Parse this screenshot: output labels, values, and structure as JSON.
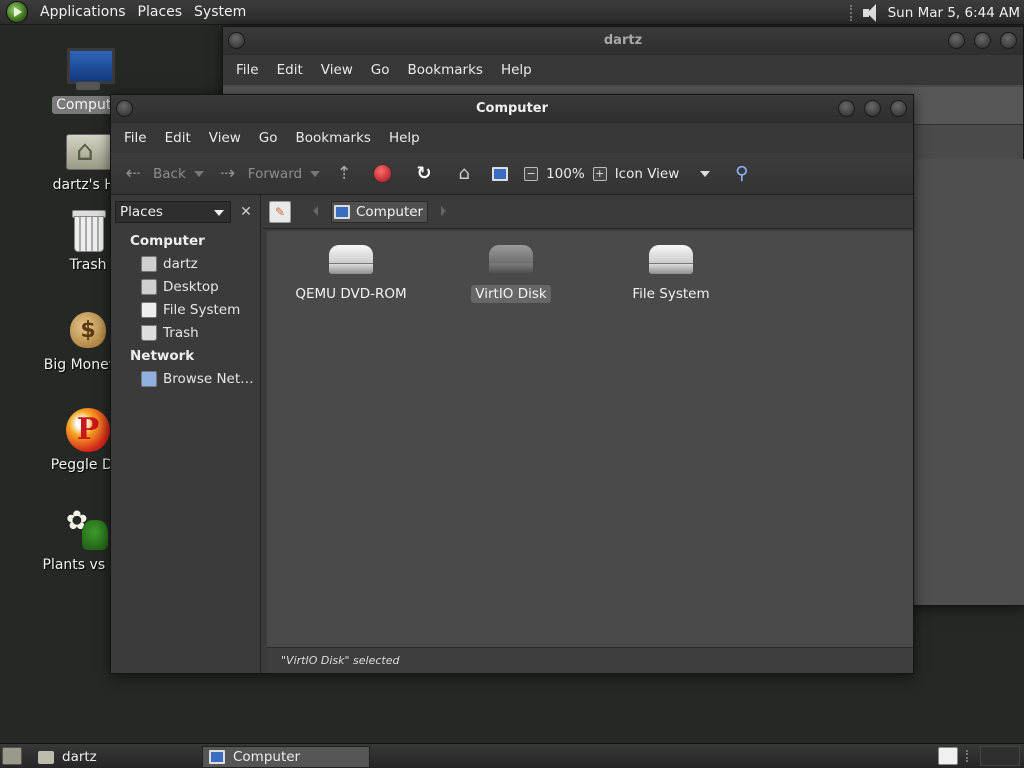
{
  "top_panel": {
    "menus": [
      "Applications",
      "Places",
      "System"
    ],
    "clock": "Sun Mar 5,  6:44 AM"
  },
  "desktop_icons": [
    {
      "label": "Compute",
      "icon": "computer-monitor-icon",
      "selected": true
    },
    {
      "label": "dartz's Ho",
      "icon": "home-folder-icon"
    },
    {
      "label": "Trash",
      "icon": "trash-icon"
    },
    {
      "label": "Big Money D",
      "icon": "money-bag-icon"
    },
    {
      "label": "Peggle Del",
      "icon": "peggle-icon"
    },
    {
      "label": "Plants vs Zor",
      "icon": "plants-icon"
    }
  ],
  "back_window": {
    "title": "dartz",
    "menu": [
      "File",
      "Edit",
      "View",
      "Go",
      "Bookmarks",
      "Help"
    ]
  },
  "computer_window": {
    "title": "Computer",
    "menu": [
      "File",
      "Edit",
      "View",
      "Go",
      "Bookmarks",
      "Help"
    ],
    "toolbar": {
      "back": "Back",
      "forward": "Forward",
      "zoom": "100%",
      "view_mode": "Icon View"
    },
    "sidebar": {
      "combo_label": "Places",
      "sections": [
        {
          "heading": "Computer",
          "items": [
            "dartz",
            "Desktop",
            "File System",
            "Trash"
          ]
        },
        {
          "heading": "Network",
          "items": [
            "Browse Net…"
          ]
        }
      ]
    },
    "location": {
      "crumb": "Computer"
    },
    "items": [
      {
        "label": "QEMU DVD-ROM",
        "selected": false
      },
      {
        "label": "VirtIO Disk",
        "selected": true
      },
      {
        "label": "File System",
        "selected": false
      }
    ],
    "status": "\"VirtIO Disk\" selected"
  },
  "bottom_panel": {
    "tasks": [
      {
        "label": "dartz",
        "active": false
      },
      {
        "label": "Computer",
        "active": true
      }
    ]
  },
  "colors": {
    "desktop": "#262826",
    "window_bg": "#3b3b3b",
    "content_bg": "#4a4a4a",
    "selection": "#676767"
  }
}
